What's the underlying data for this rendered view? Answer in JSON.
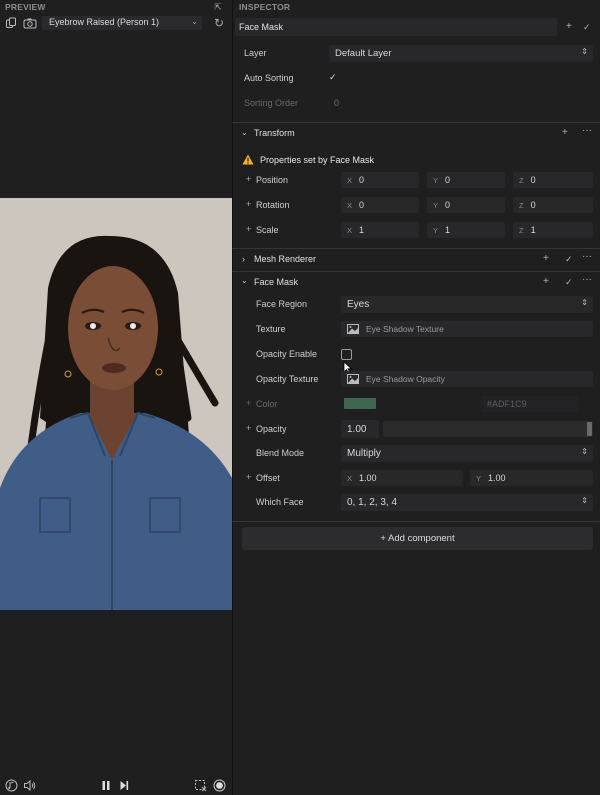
{
  "preview": {
    "title": "PREVIEW",
    "dropdown_label": "Eyebrow Raised (Person 1)"
  },
  "inspector": {
    "title": "INSPECTOR",
    "object_name": "Face Mask",
    "layer_label": "Layer",
    "layer_value": "Default Layer",
    "auto_sorting_label": "Auto Sorting",
    "sorting_order_label": "Sorting Order",
    "sorting_order_value": "0"
  },
  "transform": {
    "title": "Transform",
    "warning": "Properties set by Face Mask",
    "rows": [
      {
        "label": "Position",
        "x": "0",
        "y": "0",
        "z": "0"
      },
      {
        "label": "Rotation",
        "x": "0",
        "y": "0",
        "z": "0"
      },
      {
        "label": "Scale",
        "x": "1",
        "y": "1",
        "z": "1"
      }
    ],
    "axis_x": "X",
    "axis_y": "Y",
    "axis_z": "Z"
  },
  "mesh_renderer": {
    "title": "Mesh Renderer"
  },
  "face_mask": {
    "title": "Face Mask",
    "face_region_label": "Face Region",
    "face_region_value": "Eyes",
    "texture_label": "Texture",
    "texture_value": "Eye Shadow Texture",
    "opacity_enable_label": "Opacity Enable",
    "opacity_texture_label": "Opacity Texture",
    "opacity_texture_value": "Eye Shadow Opacity",
    "color_label": "Color",
    "color_hex": "#ADF1C9",
    "color_swatch": "#4a7f5e",
    "opacity_label": "Opacity",
    "opacity_value": "1.00",
    "blend_mode_label": "Blend Mode",
    "blend_mode_value": "Multiply",
    "offset_label": "Offset",
    "offset_x": "1.00",
    "offset_y": "1.00",
    "which_face_label": "Which Face",
    "which_face_value": "0, 1, 2, 3, 4"
  },
  "add_component": "+ Add component"
}
